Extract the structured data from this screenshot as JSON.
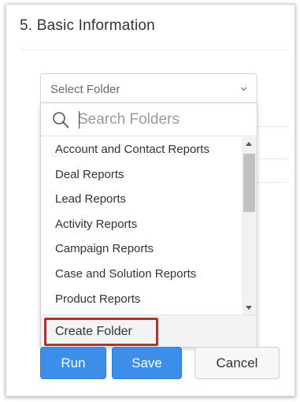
{
  "section": {
    "number": "5.",
    "title": "Basic Information"
  },
  "folder_select": {
    "selected_label": "Select Folder",
    "icon": "chevron-down-icon"
  },
  "dropdown": {
    "search_placeholder": "Search Folders",
    "search_icon": "search-icon",
    "items": [
      {
        "label": "Account and Contact Reports"
      },
      {
        "label": "Deal Reports"
      },
      {
        "label": "Lead Reports"
      },
      {
        "label": "Activity Reports"
      },
      {
        "label": "Campaign Reports"
      },
      {
        "label": "Case and Solution Reports"
      },
      {
        "label": "Product Reports"
      }
    ],
    "create_folder_label": "Create Folder",
    "highlight_color": "#a33a2e"
  },
  "actions": {
    "run_label": "Run",
    "save_label": "Save",
    "cancel_label": "Cancel",
    "primary_color": "#3c8ee8"
  }
}
